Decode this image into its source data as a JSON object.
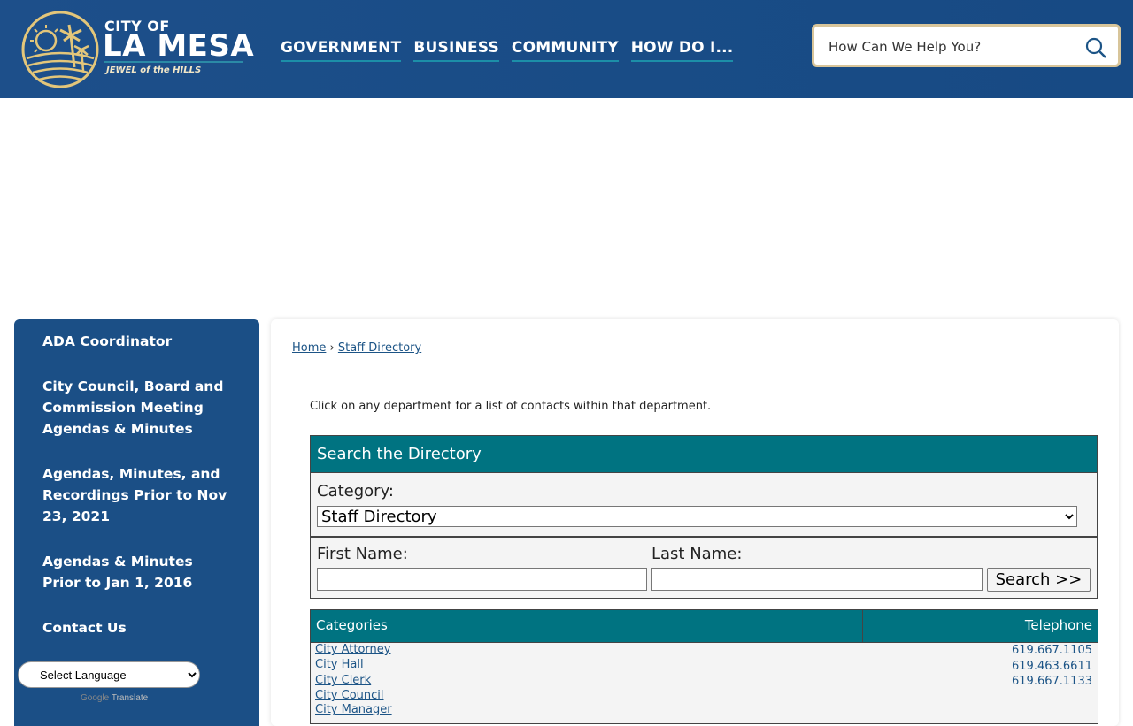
{
  "header": {
    "logo": {
      "city_of": "CITY OF",
      "la_mesa": "LA MESA",
      "tagline": "JEWEL of the HILLS"
    },
    "nav": [
      "GOVERNMENT",
      "BUSINESS",
      "COMMUNITY",
      "HOW DO I..."
    ],
    "search": {
      "placeholder": "How Can We Help You?",
      "icon": "search-icon"
    }
  },
  "sidebar": {
    "items": [
      "ADA Coordinator",
      "City Council, Board and Commission Meeting Agendas & Minutes",
      "Agendas, Minutes, and Recordings Prior to Nov 23, 2021",
      "Agendas & Minutes Prior to Jan 1, 2016",
      "Contact Us"
    ],
    "language_select": "Select Language",
    "google_label": "Google",
    "translate_label": "Translate"
  },
  "breadcrumb": {
    "home": "Home",
    "separator": "›",
    "current": "Staff Directory"
  },
  "intro": "Click on any department for a list of contacts within that department.",
  "search_box": {
    "title": "Search the Directory",
    "category_label": "Category:",
    "category_value": "Staff Directory",
    "first_name_label": "First Name:",
    "last_name_label": "Last Name:",
    "button": "Search >>"
  },
  "table": {
    "columns": [
      "Categories",
      "Telephone"
    ],
    "rows": [
      {
        "category": "City Attorney",
        "telephone": "619.667.1105"
      },
      {
        "category": "City Hall",
        "telephone": "619.463.6611"
      },
      {
        "category": "City Clerk",
        "telephone": "619.667.1133"
      },
      {
        "category": "City Council",
        "telephone": ""
      },
      {
        "category": "City Manager",
        "telephone": ""
      }
    ]
  },
  "colors": {
    "header_blue": "#1d4f8a",
    "teal": "#007381",
    "gold": "#d8c59a"
  }
}
